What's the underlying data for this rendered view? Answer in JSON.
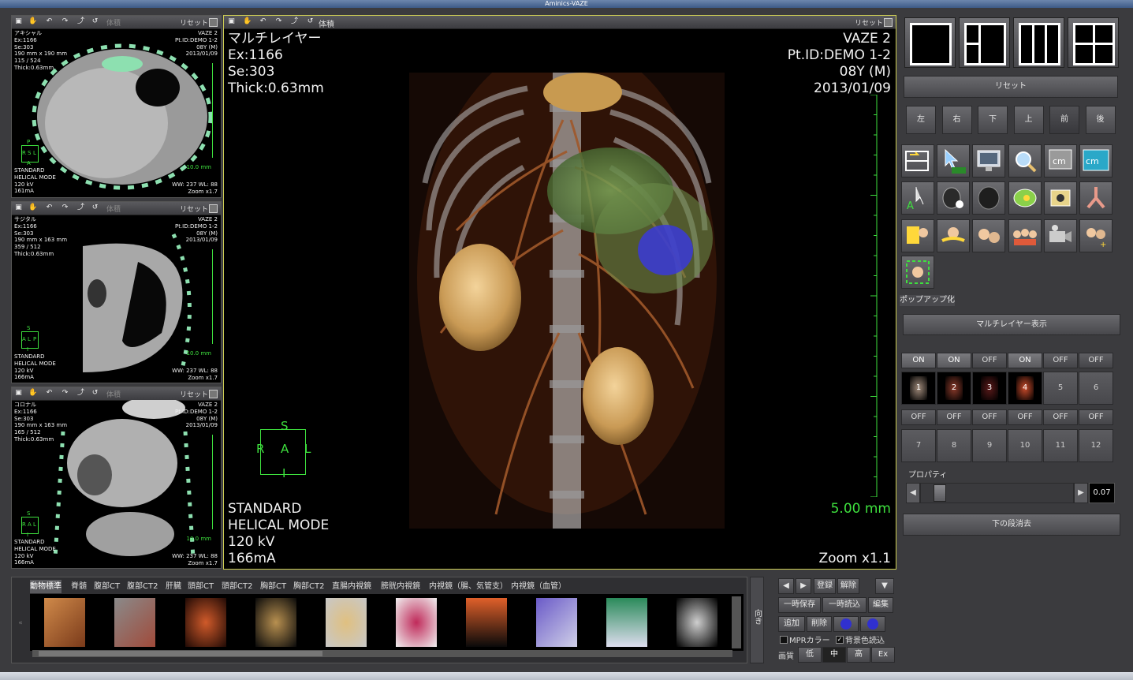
{
  "window": {
    "title": "Aminics-VAZE"
  },
  "viewer_toolbar": {
    "volume_label": "体積",
    "reset_label": "リセット"
  },
  "small_views": [
    {
      "plane": "アキシャル",
      "ex": "Ex:1166",
      "se": "Se:303",
      "fov": "190 mm x 190 mm",
      "slice": "115 / 524",
      "thick": "Thick:0.63mm",
      "app": "VAZE 2",
      "pt": "Pt.ID:DEMO 1-2",
      "age": "08Y (M)",
      "date": "2013/01/09",
      "orient": [
        "P",
        "R",
        "S",
        "L",
        "A"
      ],
      "scale": "10.0 mm",
      "protocol": "STANDARD",
      "mode": "HELICAL MODE",
      "kv": "120 kV",
      "ma": "161mA",
      "wwwl": "WW: 237   WL: 88",
      "zoom": "Zoom x1.7"
    },
    {
      "plane": "サジタル",
      "ex": "Ex:1166",
      "se": "Se:303",
      "fov": "190 mm x 163 mm",
      "slice": "359 / 512",
      "thick": "Thick:0.63mm",
      "app": "VAZE 2",
      "pt": "Pt.ID:DEMO 1-2",
      "age": "08Y (M)",
      "date": "2013/01/09",
      "orient": [
        "S",
        "A",
        "L",
        "P",
        "I"
      ],
      "scale": "10.0 mm",
      "protocol": "STANDARD",
      "mode": "HELICAL MODE",
      "kv": "120 kV",
      "ma": "166mA",
      "wwwl": "WW: 237   WL: 88",
      "zoom": "Zoom x1.7"
    },
    {
      "plane": "コロナル",
      "ex": "Ex:1166",
      "se": "Se:303",
      "fov": "190 mm x 163 mm",
      "slice": "165 / 512",
      "thick": "Thick:0.63mm",
      "app": "VAZE 2",
      "pt": "Pt.ID:DEMO 1-2",
      "age": "08Y (M)",
      "date": "2013/01/09",
      "orient": [
        "S",
        "R",
        "A",
        "L",
        "I"
      ],
      "scale": "10.0 mm",
      "protocol": "STANDARD",
      "mode": "HELICAL MODE",
      "kv": "120 kV",
      "ma": "166mA",
      "wwwl": "WW: 237   WL: 88",
      "zoom": "Zoom x1.7"
    }
  ],
  "main_view": {
    "title": "マルチレイヤー",
    "ex": "Ex:1166",
    "se": "Se:303",
    "thick": "Thick:0.63mm",
    "app": "VAZE 2",
    "pt": "Pt.ID:DEMO 1-2",
    "age": "08Y (M)",
    "date": "2013/01/09",
    "orient": [
      "S",
      "R",
      "A",
      "L",
      "I"
    ],
    "scale": "5.00 mm",
    "protocol": "STANDARD",
    "mode": "HELICAL MODE",
    "kv": "120 kV",
    "ma": "166mA",
    "zoom": "Zoom x1.1"
  },
  "right_panel": {
    "reset_label": "リセット",
    "direction_buttons": [
      "左",
      "右",
      "下",
      "上",
      "前",
      "後"
    ],
    "popup_label": "ポップアップ化",
    "multilayer_label": "マルチレイヤー表示",
    "layer_states_top": [
      "ON",
      "ON",
      "OFF",
      "ON",
      "OFF",
      "OFF"
    ],
    "layer_numbers_top": [
      "1",
      "2",
      "3",
      "4",
      "5",
      "6"
    ],
    "layer_states_bottom": [
      "OFF",
      "OFF",
      "OFF",
      "OFF",
      "OFF",
      "OFF"
    ],
    "layer_numbers_bottom": [
      "7",
      "8",
      "9",
      "10",
      "11",
      "12"
    ],
    "property_label": "プロパティ",
    "property_value": "0.07",
    "delete_lower_label": "下の段消去"
  },
  "bottom": {
    "preset_tabs": [
      "動物標準",
      "脊髄",
      "腹部CT",
      "腹部CT2",
      "肝臓",
      "頭部CT",
      "頭部CT2",
      "胸部CT",
      "胸部CT2",
      "直腸内視鏡",
      "膀胱内視鏡",
      "内視鏡（腸、気管支）",
      "内視鏡（血管）"
    ],
    "direction_label": "向き",
    "register_label": "登録",
    "release_label": "解除",
    "temp_save_label": "一時保存",
    "temp_load_label": "一時読込",
    "edit_label": "編集",
    "add_label": "追加",
    "delete_label": "削除",
    "mpr_color_label": "MPRカラー",
    "bg_color_label": "背景色読込",
    "quality_label": "画質",
    "quality_options": [
      "低",
      "中",
      "高",
      "Ex"
    ]
  }
}
